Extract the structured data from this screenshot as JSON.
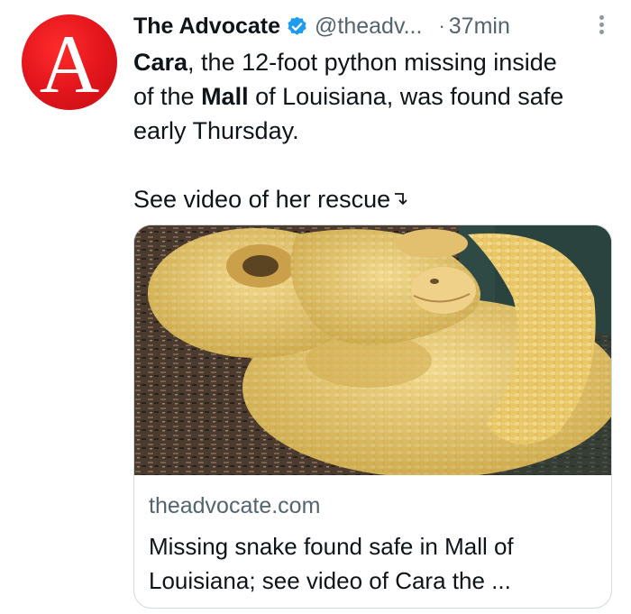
{
  "author": {
    "name": "The Advocate",
    "handle": "@theadv...",
    "separator": "·",
    "time": "37min",
    "avatar_letter": "A",
    "avatar_color": "#e0141b",
    "verified_color": "#1d9bf0"
  },
  "tweet": {
    "line1_bold": "Cara",
    "line1_rest": ", the 12-foot python missing inside",
    "line2_pre": "of the ",
    "line2_bold": "Mall",
    "line2_rest": " of Louisiana, was found safe",
    "line3": "early Thursday.",
    "line4": "See video of her rescue"
  },
  "card": {
    "image_alt": "albino python coiled on wood chips",
    "domain": "theadvocate.com",
    "title": "Missing snake found safe in Mall of Louisiana; see video of Cara the ..."
  },
  "icons": {
    "verified": "verified-badge-icon",
    "more": "more-options-icon",
    "arrow": "arrow-down-right-icon"
  }
}
